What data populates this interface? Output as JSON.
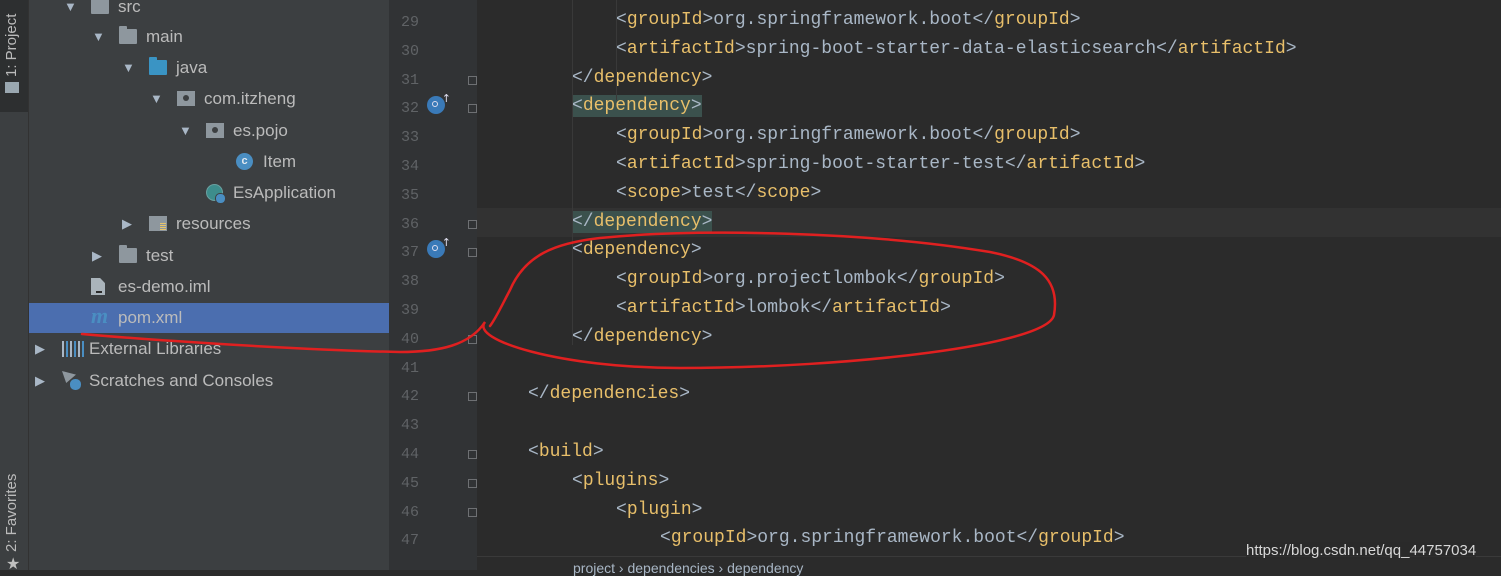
{
  "side_tabs": {
    "project": "1: Project",
    "favorites": "2: Favorites"
  },
  "tree": [
    {
      "label": "src",
      "icon": "folder-icon",
      "expanded": true
    },
    {
      "label": "main",
      "icon": "folder-icon",
      "expanded": true
    },
    {
      "label": "java",
      "icon": "source-folder-icon",
      "expanded": true
    },
    {
      "label": "com.itzheng",
      "icon": "package-icon",
      "expanded": true
    },
    {
      "label": "es.pojo",
      "icon": "package-icon",
      "expanded": true
    },
    {
      "label": "Item",
      "icon": "class-icon"
    },
    {
      "label": "EsApplication",
      "icon": "spring-boot-app-icon"
    },
    {
      "label": "resources",
      "icon": "resources-folder-icon",
      "expanded": false
    },
    {
      "label": "test",
      "icon": "folder-icon",
      "expanded": false
    },
    {
      "label": "es-demo.iml",
      "icon": "iml-file-icon"
    },
    {
      "label": "pom.xml",
      "icon": "maven-icon",
      "selected": true
    },
    {
      "label": "External Libraries",
      "icon": "libraries-icon",
      "expanded": false
    },
    {
      "label": "Scratches and Consoles",
      "icon": "scratches-icon",
      "expanded": false
    }
  ],
  "editor": {
    "current_line": "36",
    "lines": [
      {
        "num": "29",
        "text": "<groupId>org.springframework.boot</groupId>"
      },
      {
        "num": "30",
        "text": "<artifactId>spring-boot-starter-data-elasticsearch</artifactId>"
      },
      {
        "num": "31",
        "text": "</dependency>"
      },
      {
        "num": "32",
        "text": "<dependency>",
        "highlight": true
      },
      {
        "num": "33",
        "text": "<groupId>org.springframework.boot</groupId>"
      },
      {
        "num": "34",
        "text": "<artifactId>spring-boot-starter-test</artifactId>"
      },
      {
        "num": "35",
        "text": "<scope>test</scope>"
      },
      {
        "num": "36",
        "text": "</dependency>",
        "highlight": true
      },
      {
        "num": "37",
        "text": "<dependency>"
      },
      {
        "num": "38",
        "text": "<groupId>org.projectlombok</groupId>"
      },
      {
        "num": "39",
        "text": "<artifactId>lombok</artifactId>"
      },
      {
        "num": "40",
        "text": "</dependency>"
      },
      {
        "num": "41",
        "text": ""
      },
      {
        "num": "42",
        "text": "</dependencies>"
      },
      {
        "num": "43",
        "text": ""
      },
      {
        "num": "44",
        "text": "<build>"
      },
      {
        "num": "45",
        "text": "<plugins>"
      },
      {
        "num": "46",
        "text": "<plugin>"
      },
      {
        "num": "47",
        "text": "<groupId>org.springframework.boot</groupId>"
      }
    ]
  },
  "breadcrumb": [
    "project",
    "dependencies",
    "dependency"
  ],
  "watermark": "https://blog.csdn.net/qq_44757034",
  "colors": {
    "tag": "#e8bf6a",
    "text": "#a9b7c6",
    "selection": "#4b6eaf",
    "annotation": "#e02020"
  }
}
